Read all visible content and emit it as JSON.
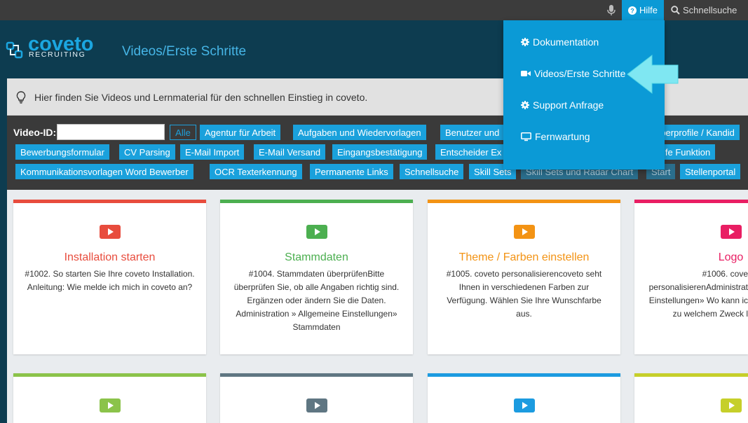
{
  "topbar": {
    "mic_icon": "microphone-icon",
    "help_label": "Hilfe",
    "search_label": "Schnellsuche"
  },
  "header": {
    "logo_word": "coveto",
    "logo_sub": "RECRUITING",
    "page_title": "Videos/Erste Schritte"
  },
  "info": {
    "text": "Hier finden Sie Videos und Lernmaterial für den schnellen Einstieg in coveto."
  },
  "filter": {
    "video_id_label": "Video-ID:",
    "video_id_value": "",
    "all_label": "Alle",
    "tags_row1": [
      "Agentur für Arbeit",
      "Aufgaben und Wiedervorlagen",
      "Benutzer und",
      "rberprofile / Kandid"
    ],
    "tags_row2": [
      "Bewerbungsformular",
      "CV Parsing",
      "E-Mail Import",
      "E-Mail Versand",
      "Eingangsbestätigung",
      "Entscheider Ex",
      "lfe Funktion"
    ],
    "tags_row3": [
      "Kommunikationsvorlagen Word Bewerber",
      "OCR Texterkennung",
      "Permanente Links",
      "Schnellsuche",
      "Skill Sets",
      "Skill Sets und Radar Chart",
      "Start",
      "Stellenportal"
    ]
  },
  "dropdown": {
    "items": [
      {
        "icon": "gear-icon",
        "label": "Dokumentation"
      },
      {
        "icon": "video-camera-icon",
        "label": "Videos/Erste Schritte"
      },
      {
        "icon": "gear-icon",
        "label": "Support Anfrage"
      },
      {
        "icon": "monitor-icon",
        "label": "Fernwartung"
      }
    ]
  },
  "cards": [
    {
      "color": "#e84c3d",
      "title": "Installation starten",
      "desc": "#1002. So starten Sie Ihre coveto Installation. Anleitung: Wie melde ich mich in coveto an?"
    },
    {
      "color": "#4caf50",
      "title": "Stammdaten",
      "desc": "#1004. Stammdaten überprüfenBitte überprüfen Sie, ob alle Angaben richtig sind. Ergänzen oder ändern Sie die Daten. Administration » Allgemeine Einstellungen» Stammdaten"
    },
    {
      "color": "#f39314",
      "title": "Theme / Farben einstellen",
      "desc": "#1005. coveto personalisierencoveto seht Ihnen in verschiedenen Farben zur Verfügung. Wählen Sie Ihre Wunschfarbe aus."
    },
    {
      "color": "#e91e63",
      "title": "Logo",
      "desc": "#1006. cove personalisierenAdministrat Einstellungen» Wo kann ic zu welchem Zweck l"
    },
    {
      "color": "#8bc34a",
      "title": "",
      "desc": ""
    },
    {
      "color": "#5f7682",
      "title": "",
      "desc": ""
    },
    {
      "color": "#1c9be0",
      "title": "",
      "desc": ""
    },
    {
      "color": "#c6cf2a",
      "title": "",
      "desc": ""
    }
  ]
}
